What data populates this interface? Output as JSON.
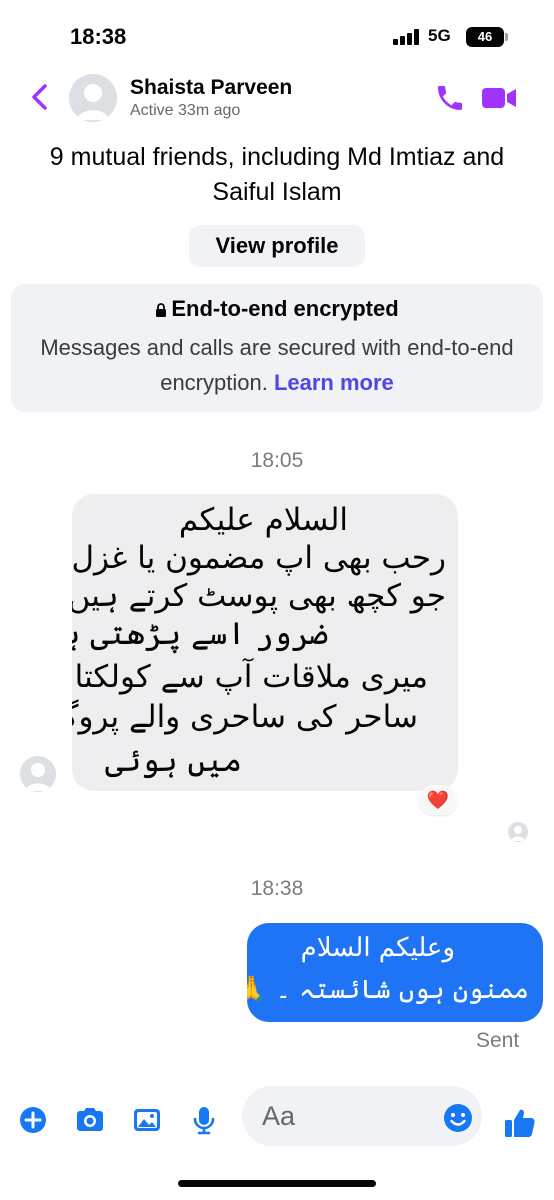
{
  "status_bar": {
    "time": "18:38",
    "network": "5G",
    "battery": "46"
  },
  "header": {
    "contact_name": "Shaista Parveen",
    "status": "Active 33m ago"
  },
  "profile": {
    "mutual_friends": "9 mutual friends, including Md Imtiaz and Saiful Islam",
    "view_profile_label": "View profile"
  },
  "encryption": {
    "title": "End-to-end encrypted",
    "text": "Messages and calls are secured with end-to-end encryption.",
    "link": "Learn more"
  },
  "thread": {
    "timestamp_1": "18:05",
    "incoming": {
      "lines": [
        "السلام علیکم",
        "رحب بھی اپ مضمون یا غزل",
        "جو کچھ بھی پوسٹ کرتے ہیں میں",
        "ضرور اسے پڑھتی ہوں",
        "میری ملاقات آپ سے کولکتا میں",
        "ساحر کی ساحری والے پروگرام",
        "میں ہوئی"
      ],
      "reaction": "❤️"
    },
    "timestamp_2": "18:38",
    "outgoing": {
      "lines": [
        "وعلیکم السلام",
        "ممنون ہوں شائستہ ۔ 🙏"
      ],
      "status": "Sent"
    }
  },
  "composer": {
    "placeholder": "Aa"
  },
  "colors": {
    "accent": "#a033ff",
    "link": "#4f46e5",
    "outgoing_bubble": "#1f74f5",
    "toolbar_icon": "#1877f2"
  }
}
